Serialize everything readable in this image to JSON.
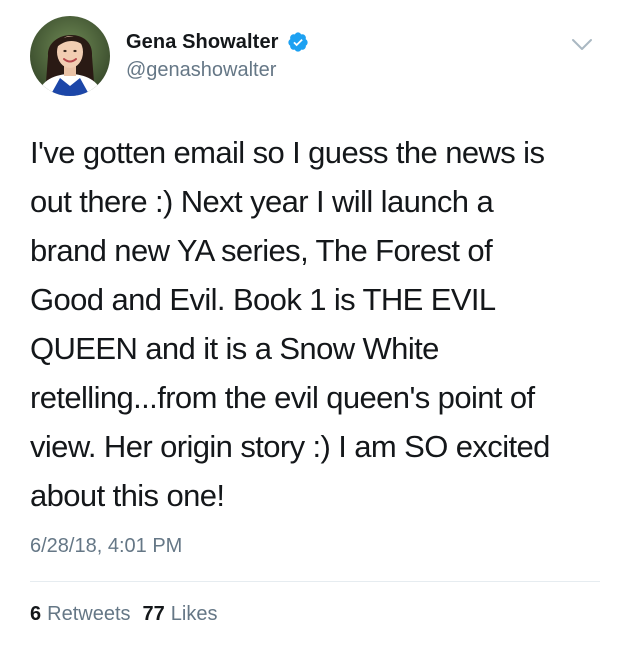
{
  "author": {
    "display_name": "Gena Showalter",
    "handle": "@genashowalter",
    "verified": true,
    "avatar_icon": "profile-photo"
  },
  "tweet": {
    "text": "I've gotten email so I guess the news is\nout there :) Next year I will launch a\nbrand new YA series, The Forest of\nGood and Evil. Book 1 is THE EVIL\nQUEEN and it is a Snow White\nretelling...from the evil queen's point of\nview. Her origin story :) I am SO excited\nabout this one!",
    "timestamp": "6/28/18, 4:01 PM"
  },
  "stats": {
    "retweets_count": "6",
    "retweets_label": "Retweets",
    "likes_count": "77",
    "likes_label": "Likes"
  },
  "colors": {
    "text_primary": "#14171a",
    "text_secondary": "#657786",
    "verified_blue": "#1da1f2",
    "divider": "#e6ecf0"
  },
  "icons": {
    "verified": "verified-badge-icon",
    "more": "chevron-down-icon"
  }
}
